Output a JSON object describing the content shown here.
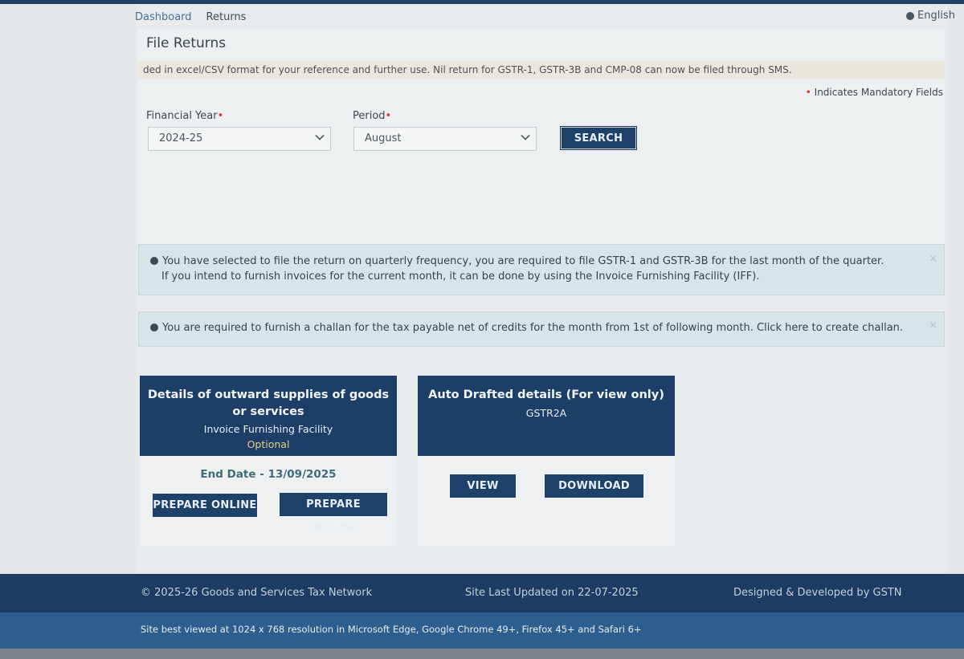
{
  "breadcrumb": {
    "dashboard": "Dashboard",
    "current": "Returns"
  },
  "language": "English",
  "page_title": "File Returns",
  "marquee": "ded in excel/CSV format for your reference and further use. Nil return for GSTR-1, GSTR-3B and CMP-08 can now be filed through SMS.",
  "mandatory_note": {
    "star": "•",
    "text": "Indicates Mandatory Fields"
  },
  "form": {
    "financial_year_label": "Financial Year",
    "financial_year_value": "2024-25",
    "period_label": "Period",
    "period_value": "August",
    "required_star": "•",
    "search_label": "SEARCH"
  },
  "alerts": {
    "quarterly_line1": "You have selected to file the return on quarterly frequency, you are required to file GSTR-1 and GSTR-3B for the last month of the quarter.",
    "quarterly_line2": "If you intend to furnish invoices for the current month, it can be done by using the Invoice Furnishing Facility (IFF).",
    "challan": "You are required to furnish a challan for the tax payable net of credits for the month from 1st of following month. Click here to create challan.",
    "close": "×"
  },
  "card_outward": {
    "title_line1": "Details of outward supplies of goods",
    "title_line2": "or services",
    "subtitle": "Invoice Furnishing Facility",
    "optional": "Optional",
    "end_date_label": "End Date -",
    "end_date_value": "13/09/2025",
    "prepare_online": "PREPARE ONLINE",
    "prepare_offline": "PREPARE OFFLINE"
  },
  "card_auto": {
    "title": "Auto Drafted details (For view only)",
    "subtitle": "GSTR2A",
    "view": "VIEW",
    "download": "DOWNLOAD"
  },
  "footer": {
    "copyright": "© 2025-26 Goods and Services Tax Network",
    "last_updated": "Site Last Updated on 22-07-2025",
    "designed": "Designed & Developed by GSTN",
    "best_viewed": "Site best viewed at 1024 x 768 resolution in Microsoft Edge, Google Chrome 49+, Firefox 45+ and Safari 6+"
  },
  "colors": {
    "header_navy": "#1d3f67",
    "button_navy": "#1f4068",
    "alert_bg": "#d7e5e9",
    "required": "#d43a3a",
    "optional": "#e4cf7a"
  }
}
